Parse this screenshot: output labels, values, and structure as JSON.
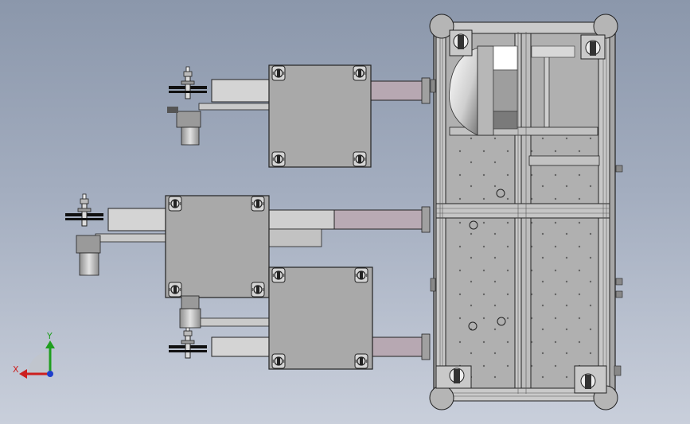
{
  "window": {
    "view": "top view"
  },
  "triad": {
    "x_label": "X",
    "y_label": "Y",
    "x_color": "#cc1f1f",
    "y_color": "#1f9e1f",
    "z_color": "#1f3fcc"
  },
  "colors": {
    "background_top": "#8b97ab",
    "background_bottom": "#c9cfdb",
    "plate": "#a9a9a9",
    "rail": "#c4c4c4",
    "arm": "#b4a7b1",
    "outline": "#2a2a2a"
  },
  "parts": {
    "frame": "aluminum-profile-frame",
    "caster_count": 4,
    "module_count": 3
  }
}
